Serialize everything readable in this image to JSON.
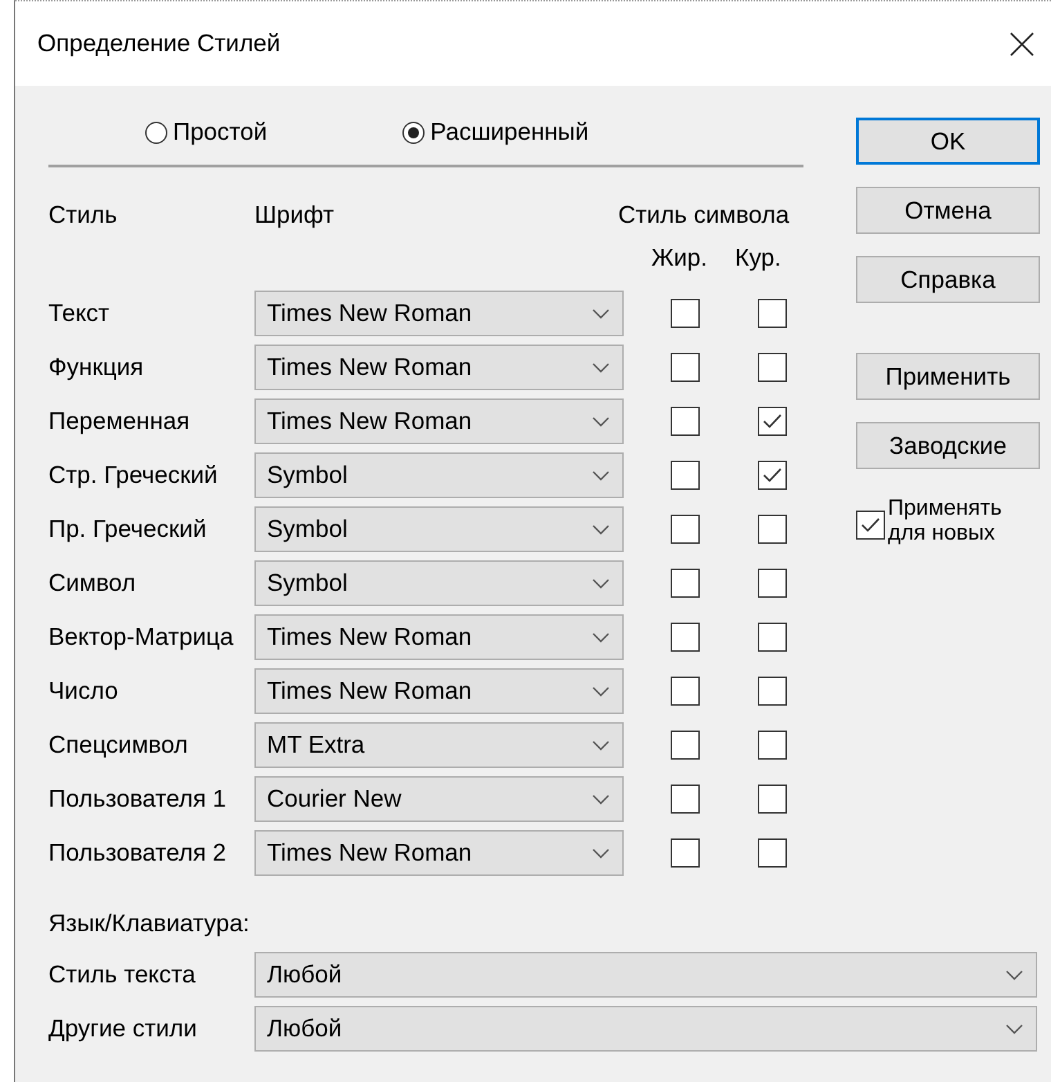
{
  "window": {
    "title": "Определение Стилей"
  },
  "mode_options": [
    {
      "label": "Простой",
      "selected": false
    },
    {
      "label": "Расширенный",
      "selected": true
    }
  ],
  "columns": {
    "style": "Стиль",
    "font": "Шрифт",
    "char_style": "Стиль символа",
    "bold": "Жир.",
    "italic": "Кур."
  },
  "styles": [
    {
      "name": "Текст",
      "font": "Times New Roman",
      "bold": false,
      "italic": false
    },
    {
      "name": "Функция",
      "font": "Times New Roman",
      "bold": false,
      "italic": false
    },
    {
      "name": "Переменная",
      "font": "Times New Roman",
      "bold": false,
      "italic": true
    },
    {
      "name": "Стр. Греческий",
      "font": "Symbol",
      "bold": false,
      "italic": true
    },
    {
      "name": "Пр. Греческий",
      "font": "Symbol",
      "bold": false,
      "italic": false
    },
    {
      "name": "Символ",
      "font": "Symbol",
      "bold": false,
      "italic": false
    },
    {
      "name": "Вектор-Матрица",
      "font": "Times New Roman",
      "bold": false,
      "italic": false
    },
    {
      "name": "Число",
      "font": "Times New Roman",
      "bold": false,
      "italic": false
    },
    {
      "name": "Спецсимвол",
      "font": "MT Extra",
      "bold": false,
      "italic": false
    },
    {
      "name": "Пользователя 1",
      "font": "Courier New",
      "bold": false,
      "italic": false
    },
    {
      "name": "Пользователя 2",
      "font": "Times New Roman",
      "bold": false,
      "italic": false
    }
  ],
  "language_label": "Язык/Клавиатура:",
  "language_rows": [
    {
      "label": "Стиль текста",
      "value": "Любой"
    },
    {
      "label": "Другие стили",
      "value": "Любой"
    }
  ],
  "buttons": [
    {
      "label": "OK",
      "focused": true
    },
    {
      "label": "Отмена",
      "focused": false
    },
    {
      "label": "Справка",
      "focused": false
    },
    {
      "label": "Применить",
      "focused": false
    },
    {
      "label": "Заводские",
      "focused": false
    }
  ],
  "apply_to_new": {
    "label": "Применять для новых",
    "checked": true
  }
}
